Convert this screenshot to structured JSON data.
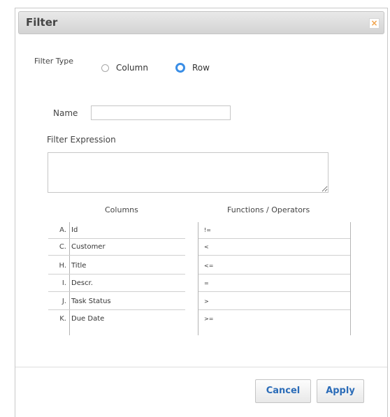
{
  "dialog": {
    "title": "Filter",
    "close_glyph": "×",
    "filter_type_label": "Filter Type",
    "filter_type_options": [
      {
        "label": "Column",
        "checked": false
      },
      {
        "label": "Row",
        "checked": true
      }
    ],
    "name_label": "Name",
    "name_value": "",
    "expression_label": "Filter Expression",
    "expression_value": "",
    "columns_header": "Columns",
    "functions_header": "Functions / Operators",
    "columns": [
      {
        "letter": "A.",
        "name": "Id"
      },
      {
        "letter": "C.",
        "name": "Customer"
      },
      {
        "letter": "H.",
        "name": "Title"
      },
      {
        "letter": "I.",
        "name": "Descr."
      },
      {
        "letter": "J.",
        "name": "Task Status"
      },
      {
        "letter": "K.",
        "name": "Due Date"
      }
    ],
    "operators": [
      "!=",
      "<",
      "<=",
      "=",
      ">",
      ">="
    ],
    "cancel_label": "Cancel",
    "apply_label": "Apply"
  },
  "colors": {
    "accent": "#3a8ee6",
    "button_text": "#2b6cb8",
    "close_icon": "#f0a24a"
  },
  "icons": {
    "close": "close-icon",
    "radio_selected": "radio-selected-icon",
    "resize": "resize-handle-icon"
  }
}
